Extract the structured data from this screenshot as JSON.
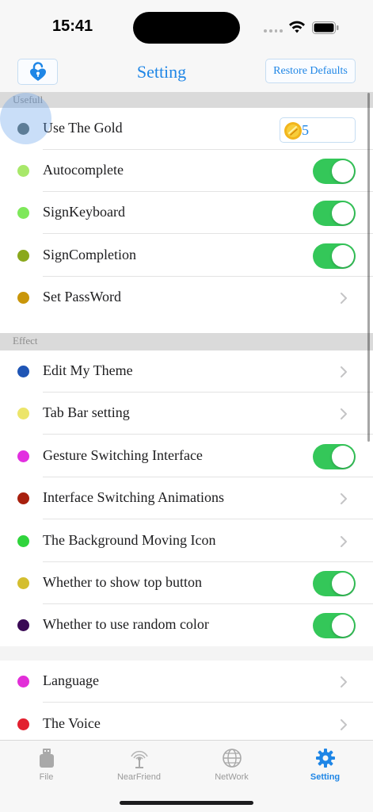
{
  "status_bar": {
    "time": "15:41"
  },
  "nav": {
    "title": "Setting",
    "restore_label": "Restore Defaults"
  },
  "sections": [
    {
      "header": "Usefull"
    },
    {
      "header": "Effect"
    }
  ],
  "rows": [
    {
      "label": "Use The Gold",
      "dot_color": "#5a6b6b",
      "accessory": "gold",
      "gold_value": "5"
    },
    {
      "label": "Autocomplete",
      "dot_color": "#a8e86a",
      "accessory": "toggle",
      "on": true
    },
    {
      "label": "SignKeyboard",
      "dot_color": "#7ee85a",
      "accessory": "toggle",
      "on": true
    },
    {
      "label": "SignCompletion",
      "dot_color": "#8aa81c",
      "accessory": "toggle",
      "on": true
    },
    {
      "label": "Set PassWord",
      "dot_color": "#c9960a",
      "accessory": "chevron"
    },
    {
      "label": "Edit My Theme",
      "dot_color": "#1f55b5",
      "accessory": "chevron"
    },
    {
      "label": "Tab Bar setting",
      "dot_color": "#ece56a",
      "accessory": "chevron"
    },
    {
      "label": "Gesture Switching Interface",
      "dot_color": "#e22fe0",
      "accessory": "toggle",
      "on": true
    },
    {
      "label": "Interface Switching Animations",
      "dot_color": "#a8200e",
      "accessory": "chevron"
    },
    {
      "label": "The Background Moving Icon",
      "dot_color": "#2fd43c",
      "accessory": "chevron"
    },
    {
      "label": "Whether to show top button",
      "dot_color": "#d4be2f",
      "accessory": "toggle",
      "on": true
    },
    {
      "label": "Whether to use random color",
      "dot_color": "#3a0a55",
      "accessory": "toggle",
      "on": true
    },
    {
      "label": "Language",
      "dot_color": "#e22fd8",
      "accessory": "chevron"
    },
    {
      "label": "The Voice",
      "dot_color": "#e2202f",
      "accessory": "chevron"
    }
  ],
  "tabs": [
    {
      "label": "File",
      "icon": "usb-drive-icon",
      "active": false
    },
    {
      "label": "NearFriend",
      "icon": "antenna-icon",
      "active": false
    },
    {
      "label": "NetWork",
      "icon": "globe-icon",
      "active": false
    },
    {
      "label": "Setting",
      "icon": "gear-icon",
      "active": true
    }
  ],
  "colors": {
    "accent": "#1f86e6",
    "toggle_on": "#34c759",
    "section_bg": "#dadada"
  }
}
